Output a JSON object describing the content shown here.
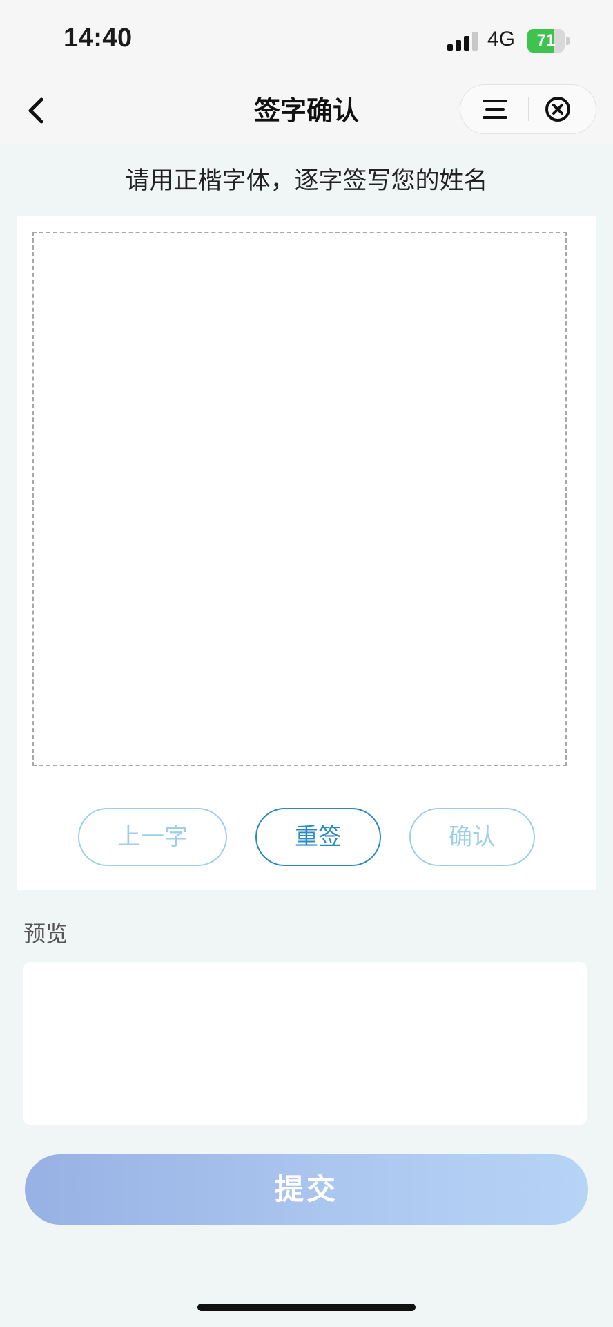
{
  "status_bar": {
    "time": "14:40",
    "network": "4G",
    "battery_percent": "71",
    "battery_level": 0.71,
    "battery_color": "#3fc34f"
  },
  "nav": {
    "title": "签字确认",
    "back_icon": "chevron-left-icon",
    "menu_icon": "menu-icon",
    "close_icon": "close-circle-icon"
  },
  "instruction": "请用正楷字体，逐字签写您的姓名",
  "buttons": {
    "prev": "上一字",
    "resign": "重签",
    "confirm": "确认"
  },
  "preview": {
    "label": "预览"
  },
  "submit": {
    "label": "提交"
  },
  "colors": {
    "accent": "#2b8ac1",
    "disabled_accent": "#9fcfe8",
    "submit_gradient_start": "#97b1e4",
    "submit_gradient_end": "#b6d4f6",
    "page_background": "#f0f5f6"
  }
}
